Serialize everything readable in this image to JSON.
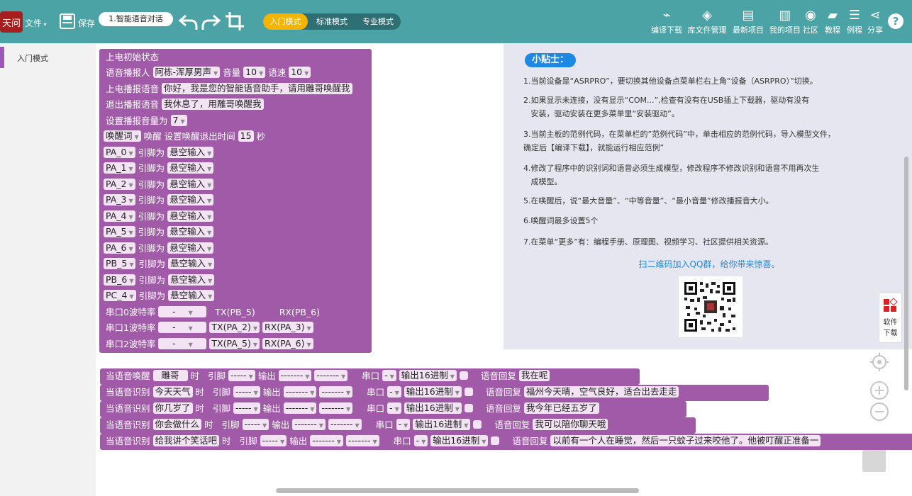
{
  "topbar": {
    "file_menu": "文件",
    "save": "保存",
    "project_name": "1.智能语音对话",
    "modes": [
      "入门模式",
      "标准模式",
      "专业模式"
    ],
    "active_mode": "入门模式",
    "right_buttons": [
      "编译下载",
      "库文件管理",
      "最新项目",
      "我的项目",
      "社区",
      "教程",
      "例程",
      "分享"
    ],
    "colors": {
      "bar": "#4ba3a5",
      "active_mode": "#f4b400",
      "mode_bg": "#2f6f73"
    }
  },
  "sidebar": {
    "items": [
      {
        "label": "入门模式"
      }
    ]
  },
  "setup_block": {
    "title": "上电初始状态",
    "voice_label": "语音播报人",
    "voice": "阿栋-浑厚男声",
    "volume_label": "音量",
    "volume": "10",
    "speed_label": "语速",
    "speed": "10",
    "power_on_label": "上电播报语音",
    "power_on_text": "你好，我是您的智能语音助手，请用雕哥唤醒我",
    "exit_label": "退出播报语音",
    "exit_text": "我休息了，用雕哥唤醒我",
    "broadcast_volume_label": "设置播报音量为",
    "broadcast_volume": "7",
    "wake_word_dd": "唤醒词",
    "wake_label": "唤醒",
    "wake_timeout_label": "设置唤醒退出时间",
    "wake_timeout": "15",
    "seconds": "秒",
    "pin_label": "引脚为",
    "pin_mode": "悬空输入",
    "pins": [
      "PA_0",
      "PA_1",
      "PA_2",
      "PA_3",
      "PA_4",
      "PA_5",
      "PA_6",
      "PB_5",
      "PB_6",
      "PC_4"
    ],
    "uarts": [
      {
        "label": "串口0波特率",
        "baud": "-",
        "tx": "TX(PB_5)",
        "rx": "RX(PB_6)",
        "tx_dd": false
      },
      {
        "label": "串口1波特率",
        "baud": "-",
        "tx": "TX(PA_2)",
        "rx": "RX(PA_3)",
        "tx_dd": true
      },
      {
        "label": "串口2波特率",
        "baud": "-",
        "tx": "TX(PA_5)",
        "rx": "RX(PA_6)",
        "tx_dd": true
      }
    ]
  },
  "rules": {
    "when": "时",
    "pin": "引脚",
    "output": "输出",
    "uart": "串口",
    "uart_val": "-",
    "hex": "输出16进制",
    "reply_label": "语音回复",
    "pin_val": "-----",
    "out_val": "-------",
    "items": [
      {
        "prefix": "当语音唤醒",
        "phrase": "雕哥",
        "reply": "我在呢"
      },
      {
        "prefix": "当语音识别",
        "phrase": "今天天气",
        "reply": "福州今天晴，空气良好，适合出去走走"
      },
      {
        "prefix": "当语音识别",
        "phrase": "你几岁了",
        "reply": "我今年已经五岁了"
      },
      {
        "prefix": "当语音识别",
        "phrase": "你会做什么",
        "reply": "我可以陪你聊天哦"
      },
      {
        "prefix": "当语音识别",
        "phrase": "给我讲个笑话吧",
        "reply": "以前有一个人在睡觉，然后一只蚊子过来咬他了。他被叮醒正准备一"
      }
    ]
  },
  "tips": {
    "title": "小贴士：",
    "items": [
      "1.当前设备是“ASRPRO”，要切换其他设备点菜单栏右上角“设备（ASRPRO）”切换。",
      "2.如果显示未连接，没有显示“COM...”,检查有没有在USB插上下载器，驱动有没有",
      "   安装，驱动安装在更多菜单里“安装驱动”。",
      "3.当前主板的范例代码，在菜单栏的”范例代码”中，单击相应的范例代码，导入模型文件，",
      "确定后【编译下载】，就能运行相应范例”",
      "4.修改了程序中的识别词和语音必须生成模型，修改程序不修改识别和语音不用再次生",
      "   成模型。",
      "5.在唤醒后，说“最大音量”、“中等音量”、“最小音量”修改播报音大小。",
      "6.唤醒词最多设置5个",
      "7.在菜单“更多”有：编程手册、原理图、视频学习、社区提供相关资源。"
    ],
    "qr_text": "扫二维码加入QQ群，给你带来惊喜。"
  },
  "side_download": {
    "label1": "软件",
    "label2": "下载"
  }
}
